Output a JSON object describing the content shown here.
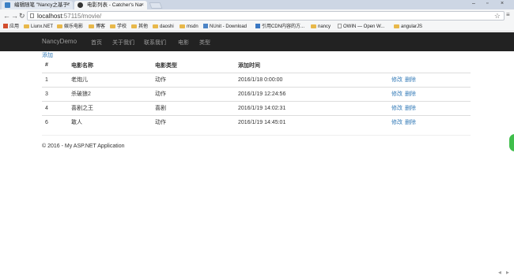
{
  "browser": {
    "tabs": [
      {
        "title": "编辑随笔 \"Nancy之基于\"",
        "active": false
      },
      {
        "title": "电影列表 - Catcher's Na",
        "active": true
      }
    ],
    "address": {
      "host": "localhost",
      "path": ":57115/movie/"
    },
    "bookmarks": [
      {
        "label": "应用",
        "icon": "apps-icon"
      },
      {
        "label": "Liunx.NET",
        "icon": "folder-icon"
      },
      {
        "label": "娱乐电影",
        "icon": "folder-icon"
      },
      {
        "label": "博客",
        "icon": "folder-icon"
      },
      {
        "label": "学校",
        "icon": "folder-icon"
      },
      {
        "label": "其他",
        "icon": "folder-icon"
      },
      {
        "label": "daoshi",
        "icon": "folder-icon"
      },
      {
        "label": "msdn",
        "icon": "folder-icon"
      },
      {
        "label": "NUnit - Download",
        "icon": "nunit-icon"
      },
      {
        "label": "引用CDN内容的方...",
        "icon": "cdn-icon"
      },
      {
        "label": "nancy",
        "icon": "folder-icon"
      },
      {
        "label": "OWIN — Open W...",
        "icon": "document-icon"
      },
      {
        "label": "angularJS",
        "icon": "folder-icon"
      }
    ]
  },
  "site": {
    "brand": "NancyDemo",
    "nav": [
      "首页",
      "关于我们",
      "联系我们",
      "电影",
      "类型"
    ],
    "add_label": "添加",
    "table": {
      "headers": [
        "#",
        "电影名称",
        "电影类型",
        "添加时间"
      ],
      "rows": [
        {
          "id": "1",
          "name": "老炮儿",
          "type": "动作",
          "date": "2016/1/18 0:00:00",
          "edit": "修改",
          "delete": "删除"
        },
        {
          "id": "3",
          "name": "杀破狼2",
          "type": "动作",
          "date": "2016/1/19 12:24:56",
          "edit": "修改",
          "delete": "删除"
        },
        {
          "id": "4",
          "name": "喜剧之王",
          "type": "喜剧",
          "date": "2016/1/19 14:02:31",
          "edit": "修改",
          "delete": "删除"
        },
        {
          "id": "6",
          "name": "敢人",
          "type": "动作",
          "date": "2016/1/19 14:45:01",
          "edit": "修改",
          "delete": "删除"
        }
      ]
    },
    "footer": "© 2016 - My ASP.NET Application"
  }
}
